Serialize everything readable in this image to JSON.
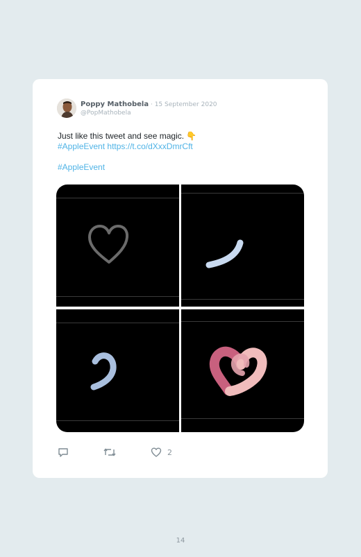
{
  "tweet": {
    "author_name": "Poppy Mathobela",
    "separator": " · ",
    "date": "15 September 2020",
    "handle": "@PopMathobela",
    "text_plain": "Just like this tweet and see magic. ",
    "text_emoji": "👇",
    "hashtag_1": "#AppleEvent",
    "link": "https://t.co/dXxxDmrCft",
    "hashtag_2": "#AppleEvent",
    "like_count": "2"
  },
  "colors": {
    "link": "#4fb3e6",
    "heart_outline": "#6b6b6b",
    "stroke_light_blue": "#c9daf0",
    "heart_pink": "#c8607e",
    "heart_light_pink": "#f0bcbc"
  },
  "icons": {
    "reply": "speech-bubble-icon",
    "retweet": "retweet-icon",
    "like": "heart-icon"
  },
  "page": {
    "number": "14"
  }
}
